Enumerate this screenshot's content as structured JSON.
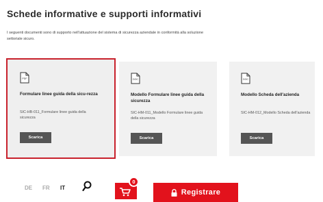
{
  "page": {
    "title": "Schede informative e supporti informativi",
    "intro": "I seguenti documenti sono di supporto nell'attuazione del sistema di sicurezza aziendale in conformità alla soluzione settoriale sicuro."
  },
  "cards": [
    {
      "icon_label": "PDF",
      "title": "Formulare linee guida della sicu-rezza",
      "code": "SIC-HB-011_Formulare linee guida della sicurezza",
      "button": "Scarica",
      "selected": true
    },
    {
      "icon_label": "DOC",
      "title": "Modello Formulare linee guida della sicurezza",
      "code": "SIC-HM-011_Modello Formulare linee guida della sicurezza",
      "button": "Scarica"
    },
    {
      "icon_label": "DOC",
      "title": "Modello Scheda dell'azienda",
      "code": "SIC-HM-012_Modello Scheda dell'azienda",
      "button": "Scarica"
    }
  ],
  "footer": {
    "languages": [
      "DE",
      "FR",
      "IT"
    ],
    "active_language": "IT",
    "cart_count": "0",
    "register_label": "Registrare"
  },
  "colors": {
    "accent": "#e2121c",
    "selection_border": "#c8202b",
    "button": "#555555"
  }
}
